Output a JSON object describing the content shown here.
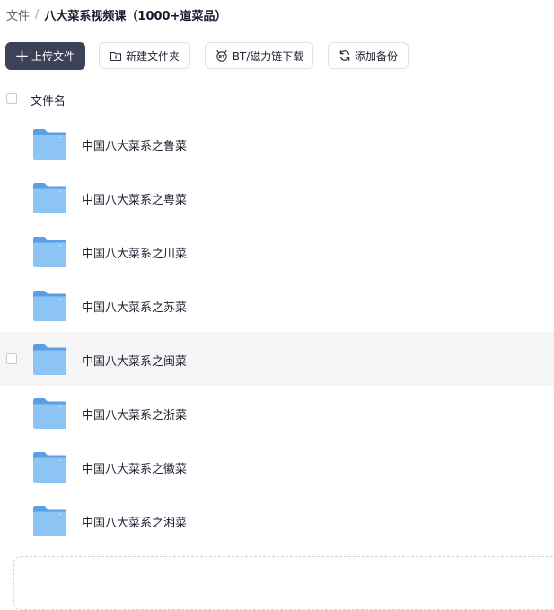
{
  "breadcrumb": {
    "root": "文件",
    "separator": "/",
    "current": "八大菜系视频课（1000+道菜品）"
  },
  "toolbar": {
    "upload_label": "上传文件",
    "new_folder_label": "新建文件夹",
    "bt_label": "BT/磁力链下载",
    "backup_label": "添加备份"
  },
  "list_header": {
    "name_label": "文件名"
  },
  "files": [
    {
      "name": "中国八大菜系之鲁菜"
    },
    {
      "name": "中国八大菜系之粤菜"
    },
    {
      "name": "中国八大菜系之川菜"
    },
    {
      "name": "中国八大菜系之苏菜"
    },
    {
      "name": "中国八大菜系之闽菜"
    },
    {
      "name": "中国八大菜系之浙菜"
    },
    {
      "name": "中国八大菜系之徽菜"
    },
    {
      "name": "中国八大菜系之湘菜"
    }
  ],
  "icons": {
    "upload": "plus-icon",
    "new_folder": "folder-plus-icon",
    "bt": "bt-magnet-icon",
    "backup": "sync-icon",
    "file": "folder-icon"
  },
  "colors": {
    "primary_button": "#3d4257",
    "folder": "#6aaeea",
    "row_hover": "#f5f5f6"
  }
}
